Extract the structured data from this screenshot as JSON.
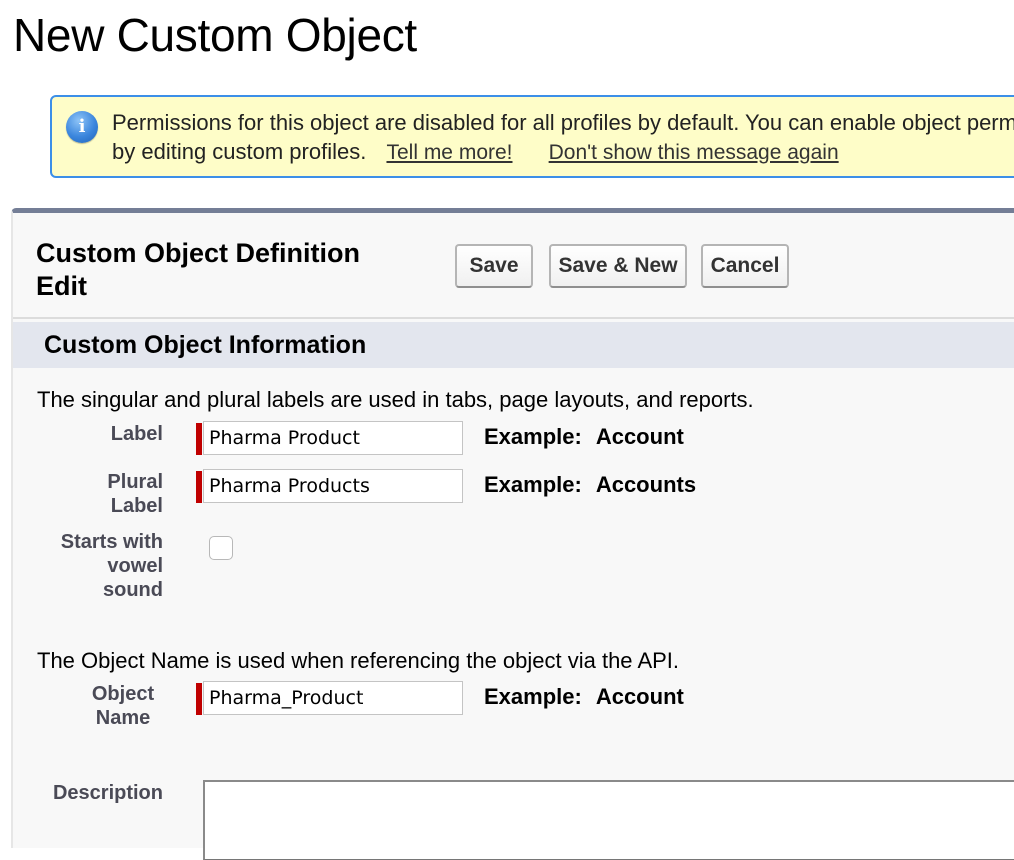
{
  "page": {
    "title": "New Custom Object"
  },
  "banner": {
    "icon": "info-icon",
    "icon_glyph": "i",
    "line1": "Permissions for this object are disabled for all profiles by default. You can enable object permissions",
    "line2": "by editing custom profiles.",
    "link_more": "Tell me more!",
    "link_dismiss": "Don't show this message again"
  },
  "panel": {
    "title": "Custom Object Definition Edit",
    "buttons": {
      "save": "Save",
      "save_new": "Save & New",
      "cancel": "Cancel"
    },
    "section_title": "Custom Object Information",
    "labels_help": "The singular and plural labels are used in tabs, page layouts, and reports.",
    "fields": {
      "label": {
        "label": "Label",
        "value": "Pharma Product",
        "example_prefix": "Example:",
        "example_value": "Account"
      },
      "plural_label": {
        "label": "Plural Label",
        "value": "Pharma Products",
        "example_prefix": "Example:",
        "example_value": "Accounts"
      },
      "vowel": {
        "label": "Starts with vowel sound",
        "checked": false
      },
      "object_name": {
        "label": "Object Name",
        "value": "Pharma_Product",
        "example_prefix": "Example:",
        "example_value": "Account"
      },
      "description": {
        "label": "Description",
        "value": ""
      }
    },
    "api_help": "The Object Name is used when referencing the object via the API."
  },
  "colors": {
    "banner_bg": "#fefdc8",
    "banner_border": "#3c8fe8",
    "panel_top_border": "#747e96",
    "section_bg": "#e3e6ee",
    "required_bar": "#c00000"
  }
}
